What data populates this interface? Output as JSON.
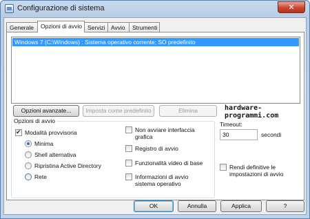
{
  "window": {
    "title": "Configurazione di sistema",
    "close_label": "✕"
  },
  "tabs": [
    {
      "label": "Generale",
      "active": false
    },
    {
      "label": "Opzioni di avvio",
      "active": true
    },
    {
      "label": "Servizi",
      "active": false
    },
    {
      "label": "Avvio",
      "active": false
    },
    {
      "label": "Strumenti",
      "active": false
    }
  ],
  "os_list": {
    "items": [
      "Windows 7 (C:\\Windows) : Sistema operativo corrente; SO predefinito"
    ],
    "selected_index": 0
  },
  "buttons": {
    "advanced": "Opzioni avanzate...",
    "set_default": "Imposta come predefinito",
    "delete": "Elimina"
  },
  "watermark": "hardware-programmi.com",
  "boot_options": {
    "title": "Opzioni di avvio",
    "safe_boot": {
      "label": "Modalità provvisoria",
      "checked": true
    },
    "radios": [
      {
        "label": "Minima",
        "checked": true
      },
      {
        "label": "Shell alternativa",
        "checked": false
      },
      {
        "label": "Ripristina Active Directory",
        "checked": false
      },
      {
        "label": "Rete",
        "checked": false
      }
    ],
    "right_checks": [
      {
        "label": "Non avviare interfaccia grafica",
        "checked": false
      },
      {
        "label": "Registro di avvio",
        "checked": false
      },
      {
        "label": "Funzionalità video di base",
        "checked": false
      },
      {
        "label": "Informazioni di avvio sistema operativo",
        "checked": false
      }
    ]
  },
  "timeout": {
    "label": "Timeout:",
    "value": "30",
    "unit": "secondi"
  },
  "persist": {
    "label": "Rendi definitive le impostazioni di avvio",
    "checked": false
  },
  "dialog_buttons": {
    "ok": "OK",
    "cancel": "Annulla",
    "apply": "Applica",
    "help": "?"
  }
}
